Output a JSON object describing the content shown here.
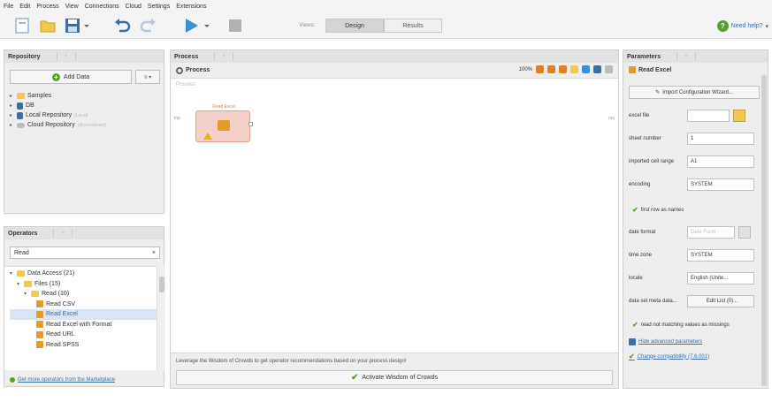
{
  "menu": [
    "File",
    "Edit",
    "Process",
    "View",
    "Connections",
    "Cloud",
    "Settings",
    "Extensions"
  ],
  "toolbar": {
    "views_label": "Views:",
    "design_tab": "Design",
    "results_tab": "Results",
    "help_label": "Need help?"
  },
  "repository": {
    "title": "Repository",
    "add_data": "Add Data",
    "items": [
      {
        "label": "Samples",
        "sub": ""
      },
      {
        "label": "DB",
        "sub": ""
      },
      {
        "label": "Local Repository",
        "sub": "(Local)"
      },
      {
        "label": "Cloud Repository",
        "sub": "(disconnected)"
      }
    ]
  },
  "operators": {
    "title": "Operators",
    "search_value": "Read",
    "tree": [
      {
        "label": "Data Access (21)",
        "level": 0
      },
      {
        "label": "Files (15)",
        "level": 1
      },
      {
        "label": "Read (10)",
        "level": 2
      },
      {
        "label": "Read CSV",
        "level": 3
      },
      {
        "label": "Read Excel",
        "level": 3,
        "selected": true
      },
      {
        "label": "Read Excel with Format",
        "level": 3
      },
      {
        "label": "Read URL",
        "level": 3
      },
      {
        "label": "Read SPSS",
        "level": 3
      }
    ],
    "marketplace_link": "Get more operators from the Marketplace"
  },
  "process": {
    "title": "Process",
    "name": "Process",
    "zoom": "100%",
    "canvas_label": "Process",
    "port_in": "inp",
    "port_out": "res",
    "operator_name": "Read Excel",
    "woc_text": "Leverage the Wisdom of Crowds to get operator recommendations based on your process design!",
    "woc_button": "Activate Wisdom of Crowds"
  },
  "parameters": {
    "title": "Parameters",
    "operator": "Read Excel",
    "import_button": "Import Configuration Wizard...",
    "rows": {
      "excel_file": {
        "label": "excel file",
        "value": ""
      },
      "sheet_number": {
        "label": "sheet number",
        "value": "1"
      },
      "imported_cell_range": {
        "label": "imported cell range",
        "value": "A1"
      },
      "encoding": {
        "label": "encoding",
        "value": "SYSTEM"
      },
      "date_format": {
        "label": "date format",
        "value": "Date Form"
      },
      "time_zone": {
        "label": "time zone",
        "value": "SYSTEM"
      },
      "locale": {
        "label": "locale",
        "value": "English (Unite..."
      },
      "data_set_meta": {
        "label": "data set meta data...",
        "value": "Edit List (0)..."
      }
    },
    "first_row_as_names": "first row as names",
    "read_not_matching": "read not matching values as missings",
    "hide_advanced": "Hide advanced parameters",
    "change_compat": "Change compatibility (7.6.001)"
  }
}
